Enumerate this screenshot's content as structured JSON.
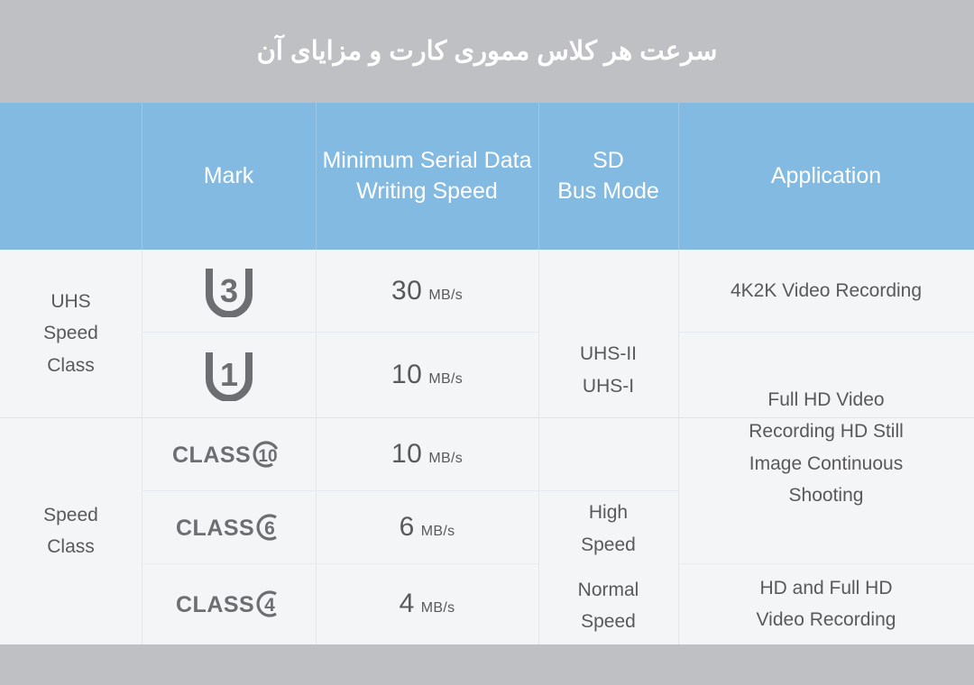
{
  "title": "سرعت هر کلاس مموری کارت و مزایای آن",
  "colors": {
    "band": "#bec0c3",
    "header_blue": "#82bae2",
    "table_bg": "#f4f5f7",
    "text_gray": "#58595b",
    "mark_gray": "#6d6e71"
  },
  "table": {
    "headers": {
      "category": "",
      "mark": "Mark",
      "speed_line1": "Minimum Serial Data",
      "speed_line2": "Writing Speed",
      "bus_line1": "SD",
      "bus_line2": "Bus Mode",
      "application": "Application"
    },
    "categories": [
      {
        "label_line1": "UHS",
        "label_line2": "Speed",
        "label_line3": "Class"
      },
      {
        "label_line1": "Speed",
        "label_line2": "Class",
        "label_line3": ""
      }
    ],
    "rows": [
      {
        "mark_type": "u-mark",
        "mark_value": "3",
        "mark_name": "uhs-speed-class-3-mark",
        "speed_value": "30",
        "speed_unit": "MB/s"
      },
      {
        "mark_type": "u-mark",
        "mark_value": "1",
        "mark_name": "uhs-speed-class-1-mark",
        "speed_value": "10",
        "speed_unit": "MB/s"
      },
      {
        "mark_type": "class-mark",
        "mark_text": "CLASS",
        "mark_value": "10",
        "mark_name": "speed-class-10-mark",
        "speed_value": "10",
        "speed_unit": "MB/s"
      },
      {
        "mark_type": "class-mark",
        "mark_text": "CLASS",
        "mark_value": "6",
        "mark_name": "speed-class-6-mark",
        "speed_value": "6",
        "speed_unit": "MB/s"
      },
      {
        "mark_type": "class-mark",
        "mark_text": "CLASS",
        "mark_value": "4",
        "mark_name": "speed-class-4-mark",
        "speed_value": "4",
        "speed_unit": "MB/s"
      }
    ],
    "bus_modes": [
      {
        "line1": "UHS-II",
        "line2": "UHS-I"
      },
      {
        "line1": "High",
        "line2": "Speed"
      },
      {
        "line1": "Normal",
        "line2": "Speed"
      }
    ],
    "applications": [
      {
        "line1": "4K2K Video Recording",
        "line2": "",
        "line3": "",
        "line4": ""
      },
      {
        "line1": "Full HD Video",
        "line2": "Recording HD Still",
        "line3": "Image Continuous",
        "line4": "Shooting"
      },
      {
        "line1": "HD and Full HD",
        "line2": "Video Recording",
        "line3": "",
        "line4": ""
      }
    ]
  }
}
